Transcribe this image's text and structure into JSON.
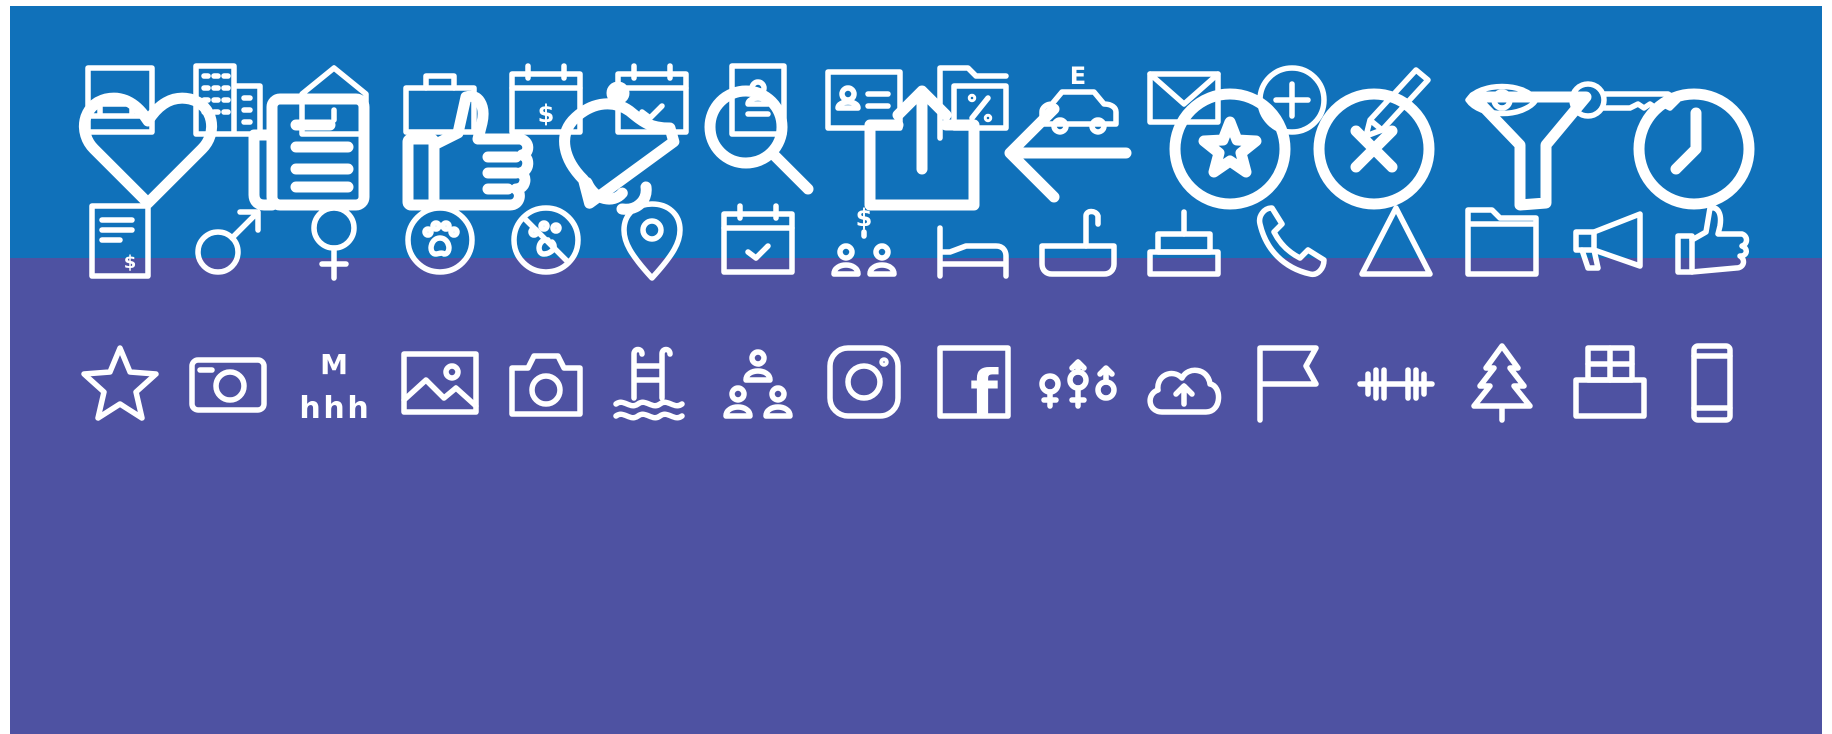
{
  "colors": {
    "top_band": "#1071ba",
    "bottom_band": "#4e52a2",
    "icon": "#ffffff"
  },
  "top_row_icons": [
    "heart-icon",
    "newspaper-icon",
    "thumbs-up-icon",
    "bell-icon",
    "search-icon",
    "share-icon",
    "arrow-left-icon",
    "star-circle-icon",
    "close-circle-icon",
    "filter-icon",
    "clock-icon"
  ],
  "grid_icons": {
    "row1": [
      "bed-frame-icon",
      "office-building-icon",
      "house-icon",
      "briefcase-icon",
      "calendar-dollar-icon",
      "calendar-check-icon",
      "id-badge-icon",
      "id-card-icon",
      "discount-folder-icon",
      "electric-car-icon",
      "mail-icon",
      "plus-circle-icon",
      "pencil-icon",
      "eye-icon",
      "key-icon"
    ],
    "row2": [
      "invoice-icon",
      "male-icon",
      "female-icon",
      "pet-friendly-icon",
      "no-pets-icon",
      "location-pin-icon",
      "calendar-check-icon",
      "paid-group-icon",
      "bed-icon",
      "bathtub-icon",
      "cake-icon",
      "phone-icon",
      "triangle-icon",
      "folder-icon",
      "megaphone-icon",
      "thumbs-up-icon"
    ],
    "row3": [
      "star-icon",
      "camera-compact-icon",
      "metro-icon",
      "image-icon",
      "camera-icon",
      "pool-ladder-icon",
      "group-icon",
      "instagram-icon",
      "facebook-icon",
      "genders-icon",
      "cloud-upload-icon",
      "flag-icon",
      "dumbbell-icon",
      "pine-tree-icon",
      "storage-box-icon",
      "smartphone-icon"
    ]
  },
  "glyphs": {
    "calendar_dollar": "$",
    "paid_group": "$",
    "electric_car": "E",
    "metro": "M",
    "metro_h": "h",
    "facebook": "f"
  }
}
